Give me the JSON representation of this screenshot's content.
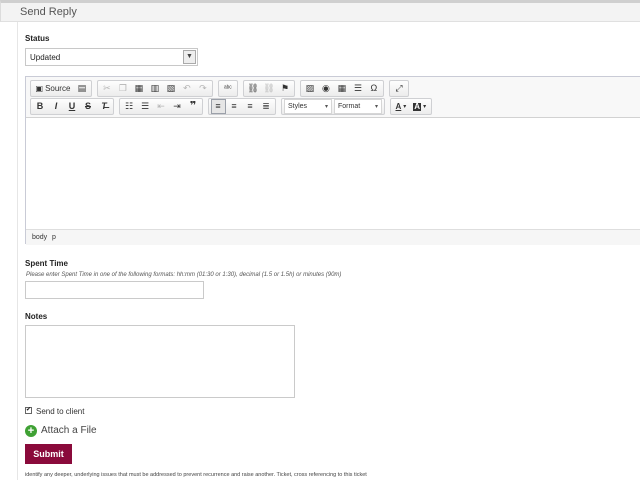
{
  "header": {
    "title": "Send Reply"
  },
  "status": {
    "label": "Status",
    "value": "Updated",
    "arrow": "▼"
  },
  "editor": {
    "row1": {
      "source_label": "Source"
    },
    "row2": {
      "styles_label": "Styles",
      "format_label": "Format",
      "caret": "▾"
    },
    "path": [
      "body",
      "p"
    ]
  },
  "spent_time": {
    "label": "Spent Time",
    "hint": "Please enter Spent Time in one of the following formats: hh:mm (01:30 or 1:30), decimal (1.5 or 1.5h) or minutes (90m)",
    "value": ""
  },
  "notes": {
    "label": "Notes",
    "value": ""
  },
  "send_to_client": {
    "label": "Send to client",
    "checked": true,
    "mark": "✔"
  },
  "attach": {
    "label": "Attach a File",
    "icon": "plus-circle-icon",
    "glyph": "+"
  },
  "submit": {
    "label": "Submit",
    "color": "#8a0a3b"
  },
  "footer_note": "identify any deeper, underlying issues that must be addressed to prevent recurrence and raise another. Ticket, cross referencing to this ticket"
}
